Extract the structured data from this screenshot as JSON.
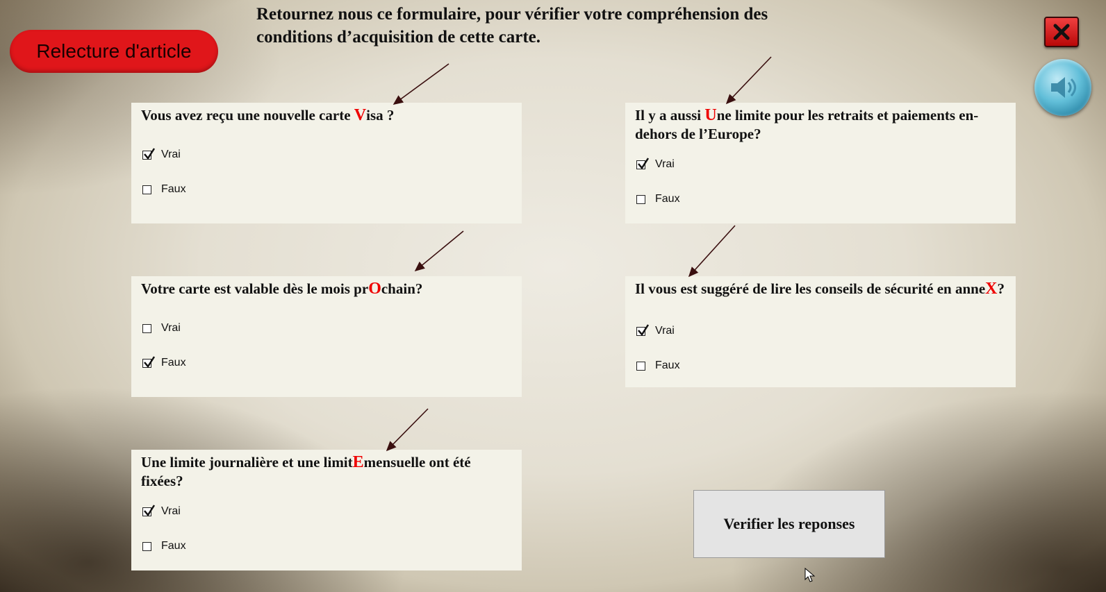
{
  "header": {
    "instruction_line1": "Retournez nous ce formulaire, pour vérifier votre compréhension des",
    "instruction_line2": "conditions d’acquisition de cette carte."
  },
  "buttons": {
    "relecture": "Relecture d'article",
    "verify": "Verifier les reponses",
    "close_icon": "close-icon",
    "sound_icon": "speaker-icon"
  },
  "questions": [
    {
      "pre": "Vous avez reçu une nouvelle carte ",
      "hl": "V",
      "post": "isa ?",
      "options": [
        "Vrai",
        "Faux"
      ],
      "checked": [
        true,
        false
      ]
    },
    {
      "pre": "Il y a aussi ",
      "hl": "U",
      "post": "ne limite pour les retraits et paiements en-dehors de l’Europe?",
      "options": [
        "Vrai",
        "Faux"
      ],
      "checked": [
        true,
        false
      ]
    },
    {
      "pre": "Votre carte est valable dès le mois pr",
      "hl": "O",
      "post": "chain?",
      "options": [
        "Vrai",
        "Faux"
      ],
      "checked": [
        false,
        true
      ]
    },
    {
      "pre": "Il vous est suggéré de lire les conseils de sécurité en anne",
      "hl": "X",
      "post": "?",
      "options": [
        "Vrai",
        "Faux"
      ],
      "checked": [
        true,
        false
      ]
    },
    {
      "pre": "Une limite journalière et une limit",
      "hl": "E",
      "post": "mensuelle ont été fixées?",
      "options": [
        "Vrai",
        "Faux"
      ],
      "checked": [
        true,
        false
      ]
    }
  ],
  "colors": {
    "accent_red": "#e0161a",
    "card_bg": "#f3f2e8",
    "highlight": "#e00000"
  }
}
